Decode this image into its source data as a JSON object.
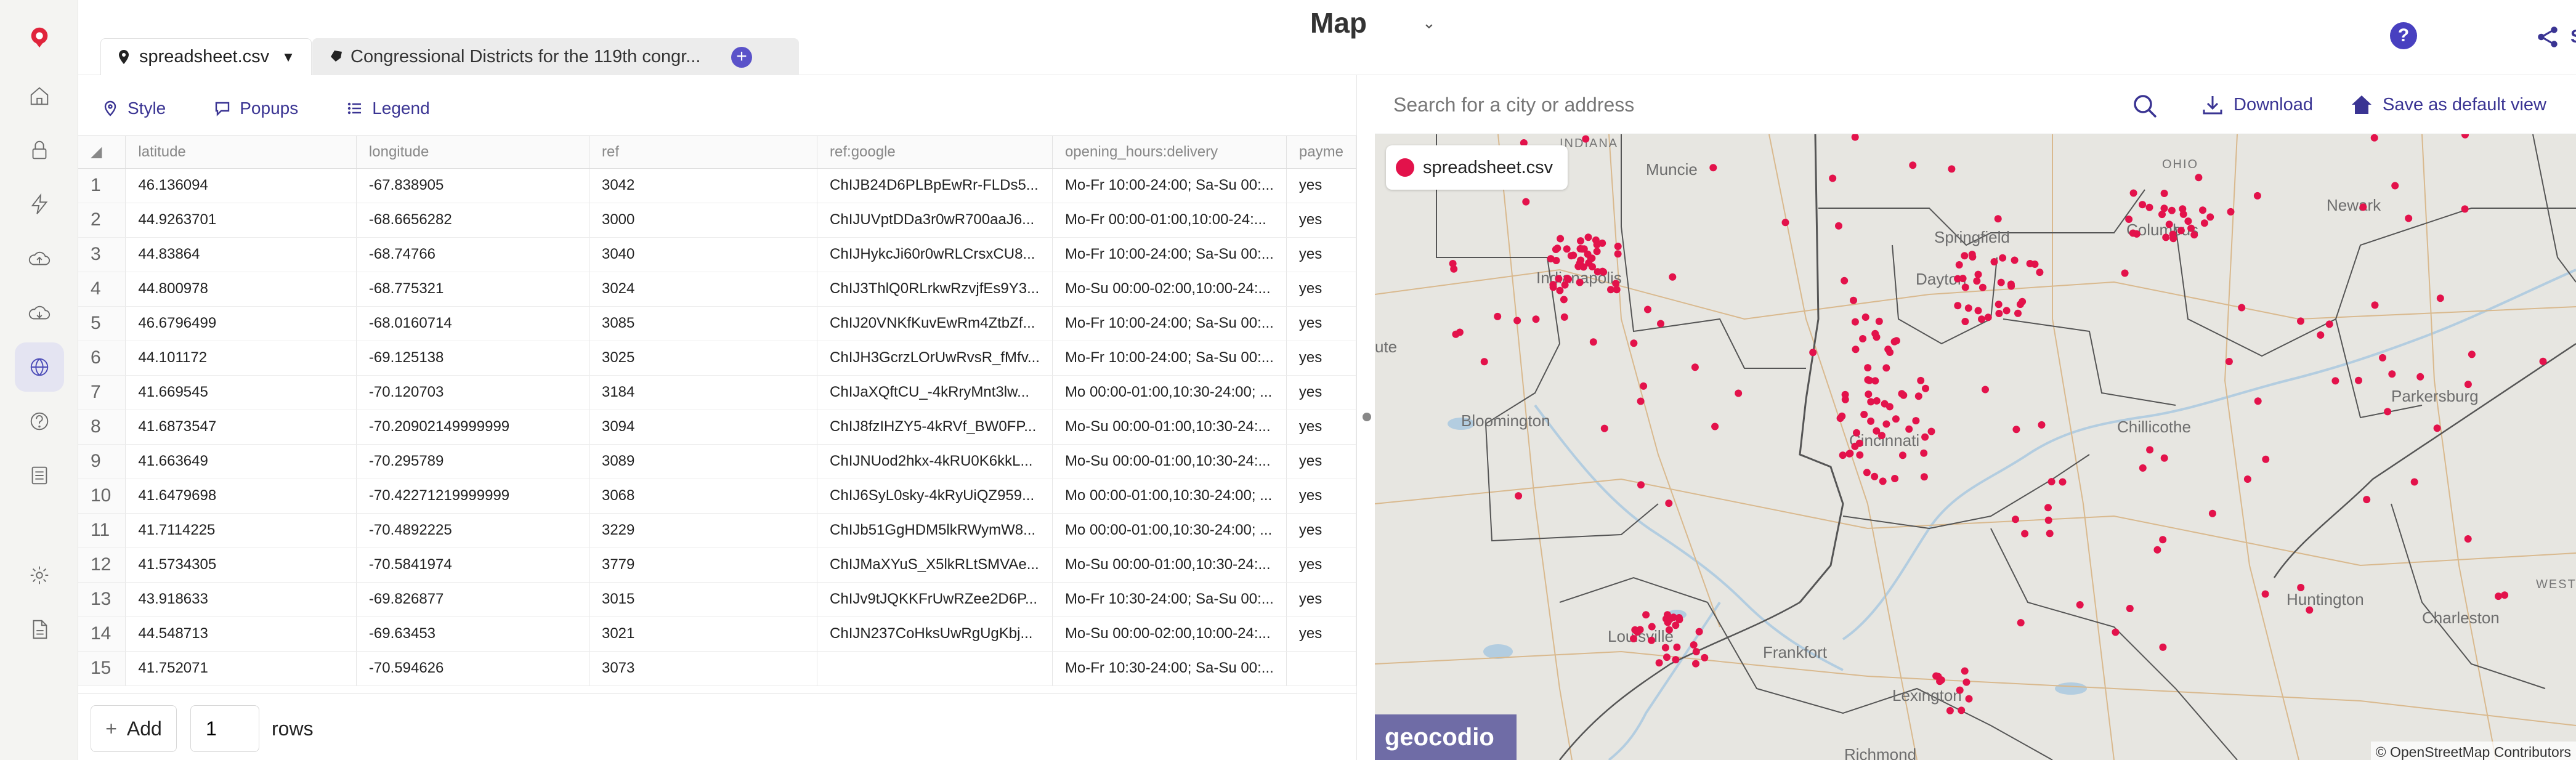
{
  "app": {
    "title": "Map",
    "help_glyph": "?",
    "share_label": "Share"
  },
  "tabs": [
    {
      "label": "spreadsheet.csv",
      "icon": "map-pin-icon",
      "active": true
    },
    {
      "label": "Congressional Districts for the 119th congr...",
      "icon": "district-shape-icon",
      "active": false
    }
  ],
  "add_tab_glyph": "+",
  "rail": [
    "home-icon",
    "lock-icon",
    "bolt-icon",
    "upload-icon",
    "download-icon",
    "globe-icon",
    "help-circle-icon",
    "spreadsheet-icon",
    "settings-icon",
    "document-icon"
  ],
  "toolbar": {
    "style_label": "Style",
    "popups_label": "Popups",
    "legend_label": "Legend"
  },
  "grid": {
    "corner_glyph": "◢",
    "columns": [
      "latitude",
      "longitude",
      "ref",
      "ref:google",
      "opening_hours:delivery",
      "payme"
    ],
    "rows": [
      {
        "n": "1",
        "cells": [
          "46.136094",
          "-67.838905",
          "3042",
          "ChIJB24D6PLBpEwRr-FLDs5...",
          "Mo-Fr 10:00-24:00; Sa-Su 00:...",
          "yes"
        ]
      },
      {
        "n": "2",
        "cells": [
          "44.9263701",
          "-68.6656282",
          "3000",
          "ChIJUVptDDa3r0wR700aaJ6...",
          "Mo-Fr 00:00-01:00,10:00-24:...",
          "yes"
        ]
      },
      {
        "n": "3",
        "cells": [
          "44.83864",
          "-68.74766",
          "3040",
          "ChIJHykcJi60r0wRLCrsxCU8...",
          "Mo-Fr 10:00-24:00; Sa-Su 00:...",
          "yes"
        ]
      },
      {
        "n": "4",
        "cells": [
          "44.800978",
          "-68.775321",
          "3024",
          "ChIJ3ThlQ0RLrkwRzvjfEs9Y3...",
          "Mo-Su 00:00-02:00,10:00-24:...",
          "yes"
        ]
      },
      {
        "n": "5",
        "cells": [
          "46.6796499",
          "-68.0160714",
          "3085",
          "ChIJ20VNKfKuvEwRm4ZtbZf...",
          "Mo-Fr 10:00-24:00; Sa-Su 00:...",
          "yes"
        ]
      },
      {
        "n": "6",
        "cells": [
          "44.101172",
          "-69.125138",
          "3025",
          "ChIJH3GcrzLOrUwRvsR_fMfv...",
          "Mo-Fr 10:00-24:00; Sa-Su 00:...",
          "yes"
        ]
      },
      {
        "n": "7",
        "cells": [
          "41.669545",
          "-70.120703",
          "3184",
          "ChIJaXQftCU_-4kRryMnt3lw...",
          "Mo 00:00-01:00,10:30-24:00; ...",
          "yes"
        ]
      },
      {
        "n": "8",
        "cells": [
          "41.6873547",
          "-70.20902149999999",
          "3094",
          "ChIJ8fzIHZY5-4kRVf_BW0FP...",
          "Mo-Su 00:00-01:00,10:30-24:...",
          "yes"
        ]
      },
      {
        "n": "9",
        "cells": [
          "41.663649",
          "-70.295789",
          "3089",
          "ChIJNUod2hkx-4kRU0K6kkL...",
          "Mo-Su 00:00-01:00,10:30-24:...",
          "yes"
        ]
      },
      {
        "n": "10",
        "cells": [
          "41.6479698",
          "-70.42271219999999",
          "3068",
          "ChIJ6SyL0sky-4kRyUiQZ959...",
          "Mo 00:00-01:00,10:30-24:00; ...",
          "yes"
        ]
      },
      {
        "n": "11",
        "cells": [
          "41.7114225",
          "-70.4892225",
          "3229",
          "ChIJb51GgHDM5lkRWymW8...",
          "Mo 00:00-01:00,10:30-24:00; ...",
          "yes"
        ]
      },
      {
        "n": "12",
        "cells": [
          "41.5734305",
          "-70.5841974",
          "3779",
          "ChIJMaXYuS_X5lkRLtSMVAe...",
          "Mo-Su 00:00-01:00,10:30-24:...",
          "yes"
        ]
      },
      {
        "n": "13",
        "cells": [
          "43.918633",
          "-69.826877",
          "3015",
          "ChIJv9tJQKKFrUwRZee2D6P...",
          "Mo-Fr 10:30-24:00; Sa-Su 00:...",
          "yes"
        ]
      },
      {
        "n": "14",
        "cells": [
          "44.548713",
          "-69.63453",
          "3021",
          "ChIJN237CoHksUwRgUgKbj...",
          "Mo-Su 00:00-02:00,10:00-24:...",
          "yes"
        ]
      },
      {
        "n": "15",
        "cells": [
          "41.752071",
          "-70.594626",
          "3073",
          "",
          "Mo-Fr 10:30-24:00; Sa-Su 00:...",
          ""
        ]
      }
    ]
  },
  "addbar": {
    "add_label": "Add",
    "add_glyph": "+",
    "rows_value": "1",
    "rows_label": "rows"
  },
  "map": {
    "search_placeholder": "Search for a city or address",
    "download_label": "Download",
    "save_view_label": "Save as default view",
    "layer_name": "spreadsheet.csv",
    "layer_color": "#e3124b",
    "attribution": "© OpenStreetMap Contributors",
    "logo_text": "geocodio",
    "states": [
      "INDIANA",
      "OHIO",
      "WEST VI"
    ],
    "cities": [
      "Muncie",
      "Springfield",
      "Columbus",
      "Newark",
      "Indianapolis",
      "Dayton",
      "Chillicothe",
      "Parkersburg",
      "ute",
      "Bloomington",
      "Cincinnati",
      "Huntington",
      "Charleston",
      "Louisville",
      "Frankfort",
      "Lexington",
      "Richmond"
    ]
  }
}
